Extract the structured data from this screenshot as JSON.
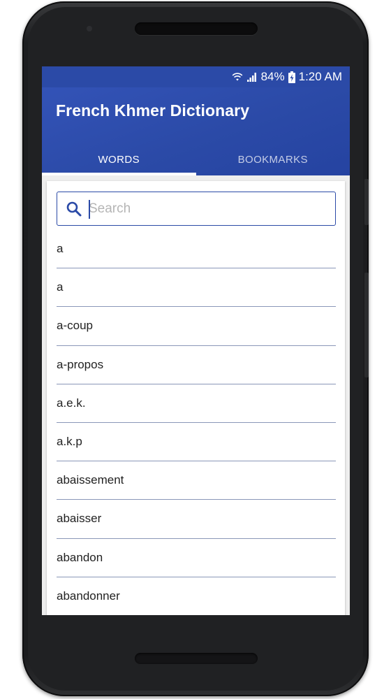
{
  "status_bar": {
    "battery": "84%",
    "time": "1:20 AM",
    "icons": [
      "wifi-icon",
      "signal-icon",
      "battery-charging-icon"
    ]
  },
  "app_bar": {
    "title": "French Khmer Dictionary"
  },
  "tabs": [
    {
      "label": "WORDS",
      "active": true
    },
    {
      "label": "BOOKMARKS",
      "active": false
    }
  ],
  "search": {
    "placeholder": "Search",
    "value": ""
  },
  "words": [
    "a",
    "a",
    "a-coup",
    "a-propos",
    "a.e.k.",
    "a.k.p",
    "abaissement",
    "abaisser",
    "abandon",
    "abandonner"
  ],
  "colors": {
    "primary": "#2b4aa7",
    "divider": "#8a97b8"
  }
}
